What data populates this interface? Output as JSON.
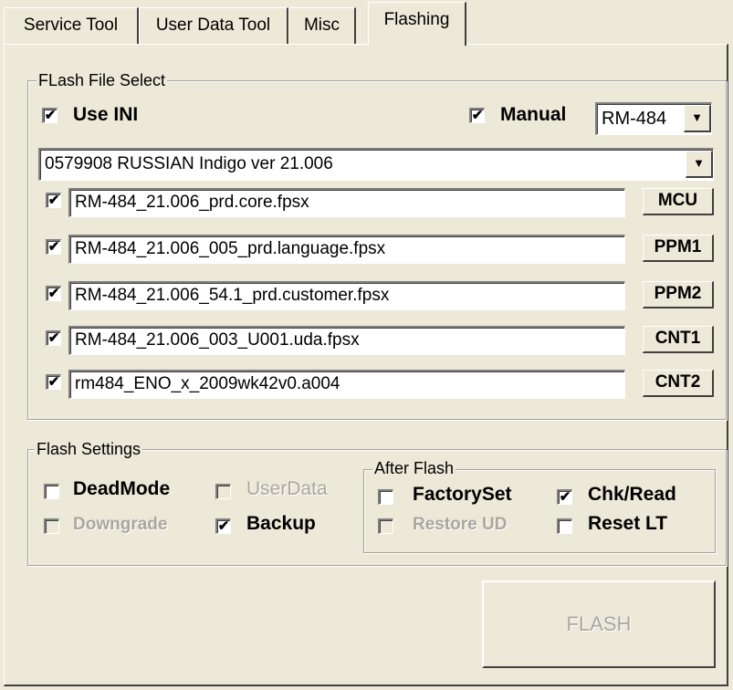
{
  "tabs": {
    "service_tool": "Service Tool",
    "user_data_tool": "User Data Tool",
    "misc": "Misc",
    "flashing": "Flashing"
  },
  "flash_file_select": {
    "title": "FLash File Select",
    "use_ini": {
      "label": "Use INI",
      "checked": true
    },
    "manual": {
      "label": "Manual",
      "checked": true
    },
    "product": {
      "value": "RM-484"
    },
    "package": {
      "value": "0579908 RUSSIAN Indigo ver 21.006"
    },
    "files": [
      {
        "value": "RM-484_21.006_prd.core.fpsx",
        "button": "MCU",
        "checked": true
      },
      {
        "value": "RM-484_21.006_005_prd.language.fpsx",
        "button": "PPM1",
        "checked": true
      },
      {
        "value": "RM-484_21.006_54.1_prd.customer.fpsx",
        "button": "PPM2",
        "checked": true
      },
      {
        "value": "RM-484_21.006_003_U001.uda.fpsx",
        "button": "CNT1",
        "checked": true
      },
      {
        "value": "rm484_ENO_x_2009wk42v0.a004",
        "button": "CNT2",
        "checked": true
      }
    ]
  },
  "flash_settings": {
    "title": "Flash Settings",
    "dead_mode": {
      "label": "DeadMode",
      "checked": false,
      "enabled": true
    },
    "user_data": {
      "label": "UserData",
      "checked": false,
      "enabled": false
    },
    "downgrade": {
      "label": "Downgrade",
      "checked": false,
      "enabled": false
    },
    "backup": {
      "label": "Backup",
      "checked": true,
      "enabled": true
    }
  },
  "after_flash": {
    "title": "After Flash",
    "factory_set": {
      "label": "FactorySet",
      "checked": false,
      "enabled": true
    },
    "chk_read": {
      "label": "Chk/Read",
      "checked": true,
      "enabled": true
    },
    "restore_ud": {
      "label": "Restore UD",
      "checked": false,
      "enabled": false
    },
    "reset_lt": {
      "label": "Reset LT",
      "checked": false,
      "enabled": true
    }
  },
  "flash_button": {
    "label": "FLASH",
    "enabled": false
  },
  "glyphs": {
    "check": "✔",
    "dropdown": "▼"
  }
}
